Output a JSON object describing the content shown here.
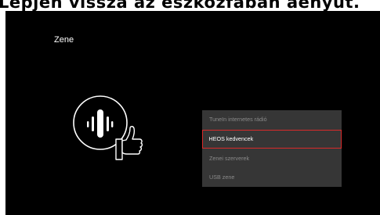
{
  "banner": {
    "text": "Lépjen vissza az eszközfában aenyüt."
  },
  "screen": {
    "title": "Zene",
    "menu": [
      {
        "label": "TuneIn internetes rádió",
        "selected": false
      },
      {
        "label": "HEOS kedvencek",
        "selected": true
      },
      {
        "label": "Zenei szerverek",
        "selected": false
      },
      {
        "label": "USB zene",
        "selected": false
      }
    ]
  },
  "colors": {
    "screen_bg": "#000000",
    "menu_bg": "#363636",
    "selection_border": "#d92a2a",
    "text_active": "#ffffff",
    "text_inactive": "#8a8a8a"
  },
  "icons": {
    "logo": "heos-hand-icon"
  }
}
